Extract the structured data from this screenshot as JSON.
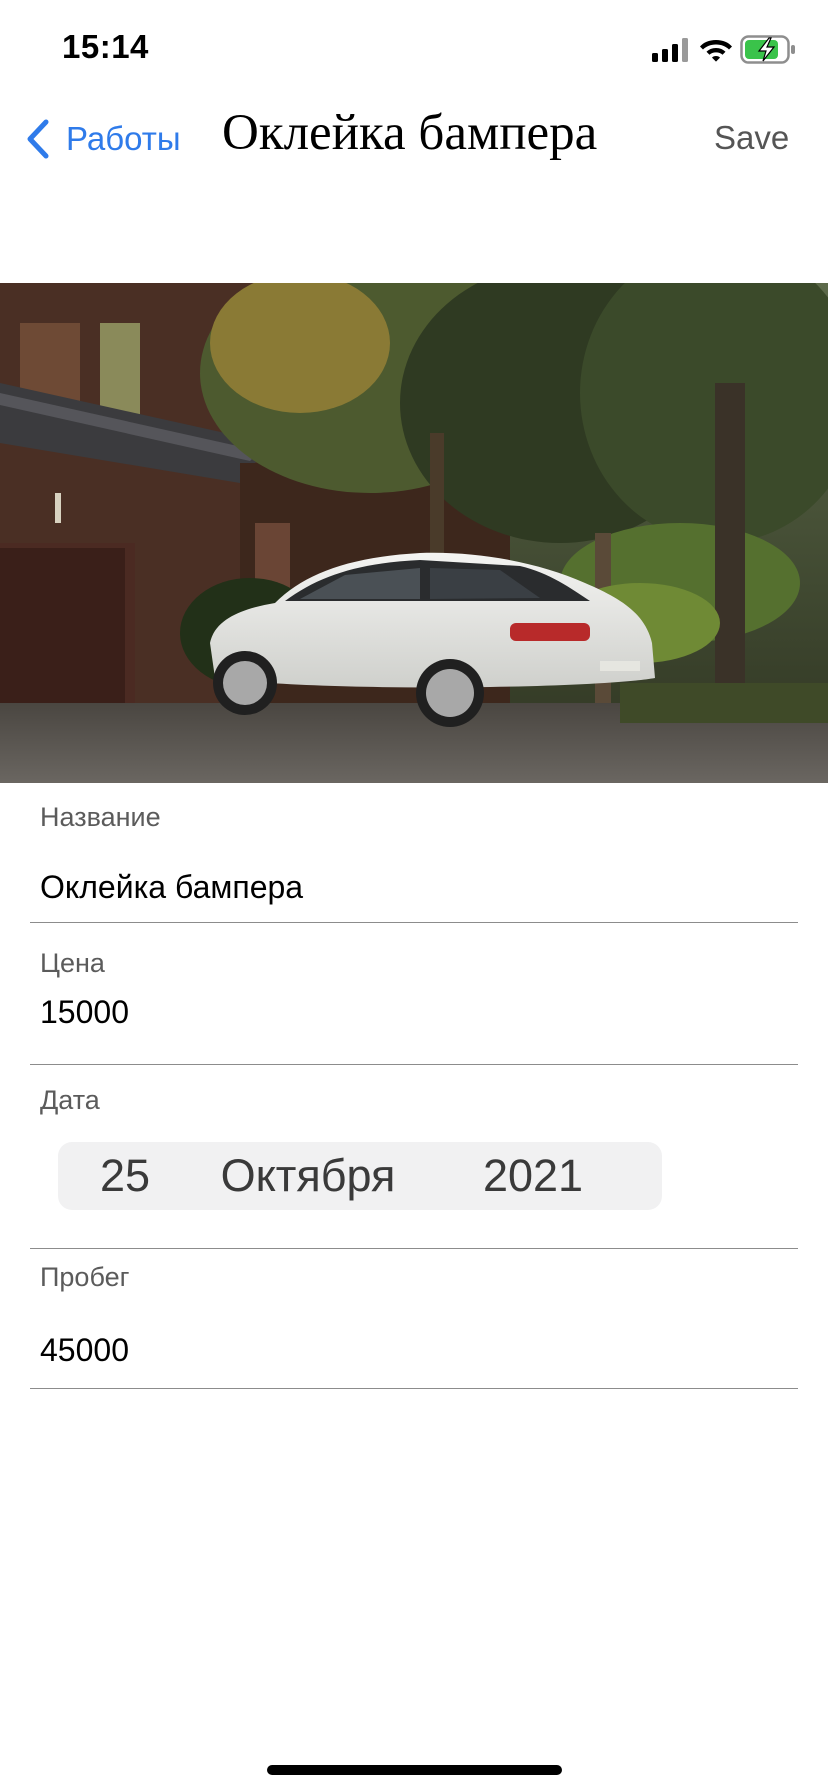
{
  "status_bar": {
    "time": "15:14"
  },
  "nav": {
    "back_label": "Работы",
    "title": "Оклейка бампера",
    "save_label": "Save"
  },
  "colors": {
    "accent": "#2f7bea",
    "battery_charging": "#3ac34a"
  },
  "form": {
    "name": {
      "label": "Название",
      "value": "Оклейка бампера"
    },
    "price": {
      "label": "Цена",
      "value": "15000"
    },
    "date": {
      "label": "Дата",
      "day": "25",
      "month": "Октября",
      "year": "2021"
    },
    "mileage": {
      "label": "Пробег",
      "value": "45000"
    }
  }
}
